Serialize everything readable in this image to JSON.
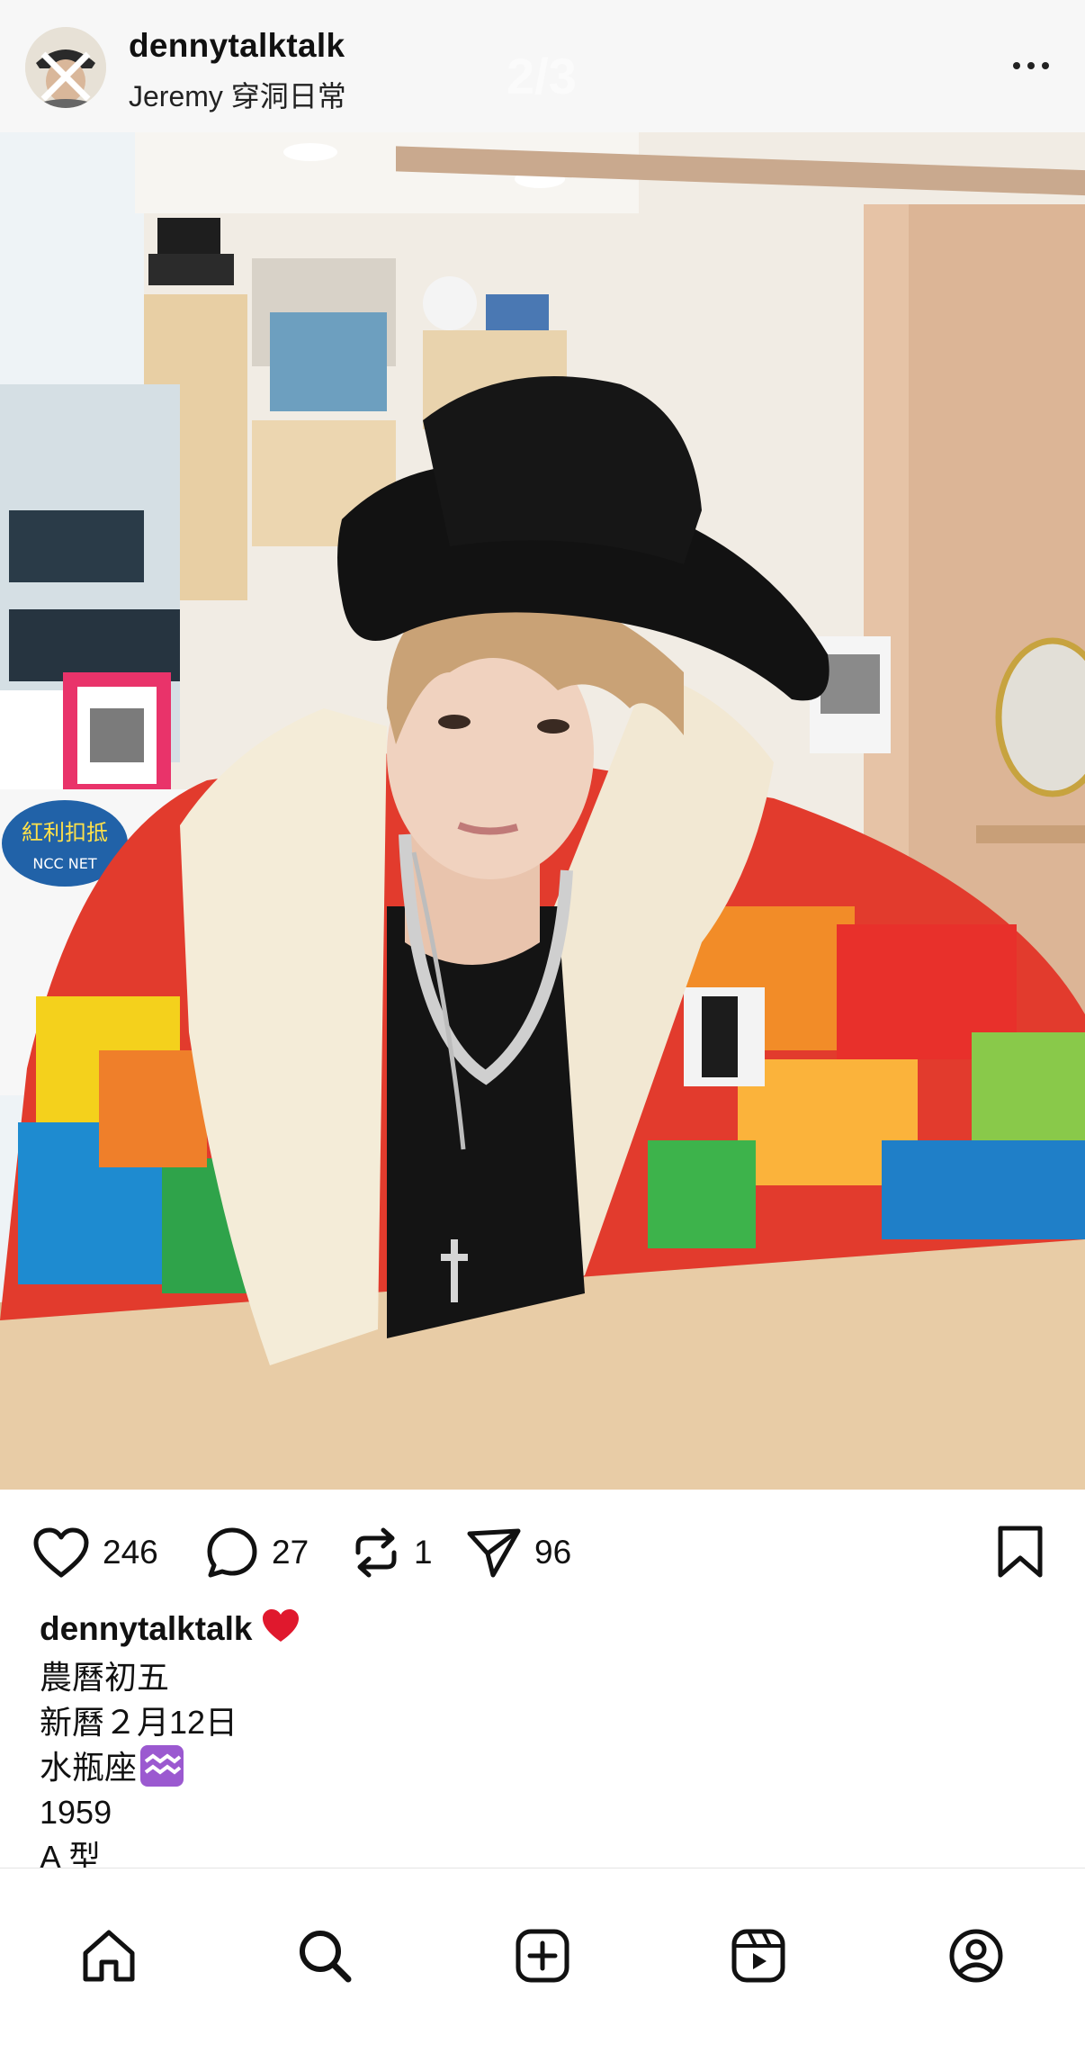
{
  "header": {
    "username": "dennytalktalk",
    "subtitle": "Jeremy 穿洞日常",
    "pager": "2/3"
  },
  "photo": {
    "description_icon": "photo-image",
    "sign_text": "紅利扣抵",
    "sign_subtext": "NCC NET"
  },
  "actions": {
    "like_count": "246",
    "comment_count": "27",
    "repost_count": "1",
    "share_count": "96"
  },
  "caption": {
    "username": "dennytalktalk",
    "lines": [
      "農曆初五",
      "新曆２月12日",
      "水瓶座",
      "1959",
      "A 型"
    ]
  },
  "nav": {
    "items": [
      "home-icon",
      "search-icon",
      "create-icon",
      "reels-icon",
      "profile-icon"
    ]
  },
  "colors": {
    "heart_emoji": "#e0182d",
    "aquarius_badge": "#9b59d0",
    "hat": "#121212",
    "fleece": "#f4ecd8"
  }
}
